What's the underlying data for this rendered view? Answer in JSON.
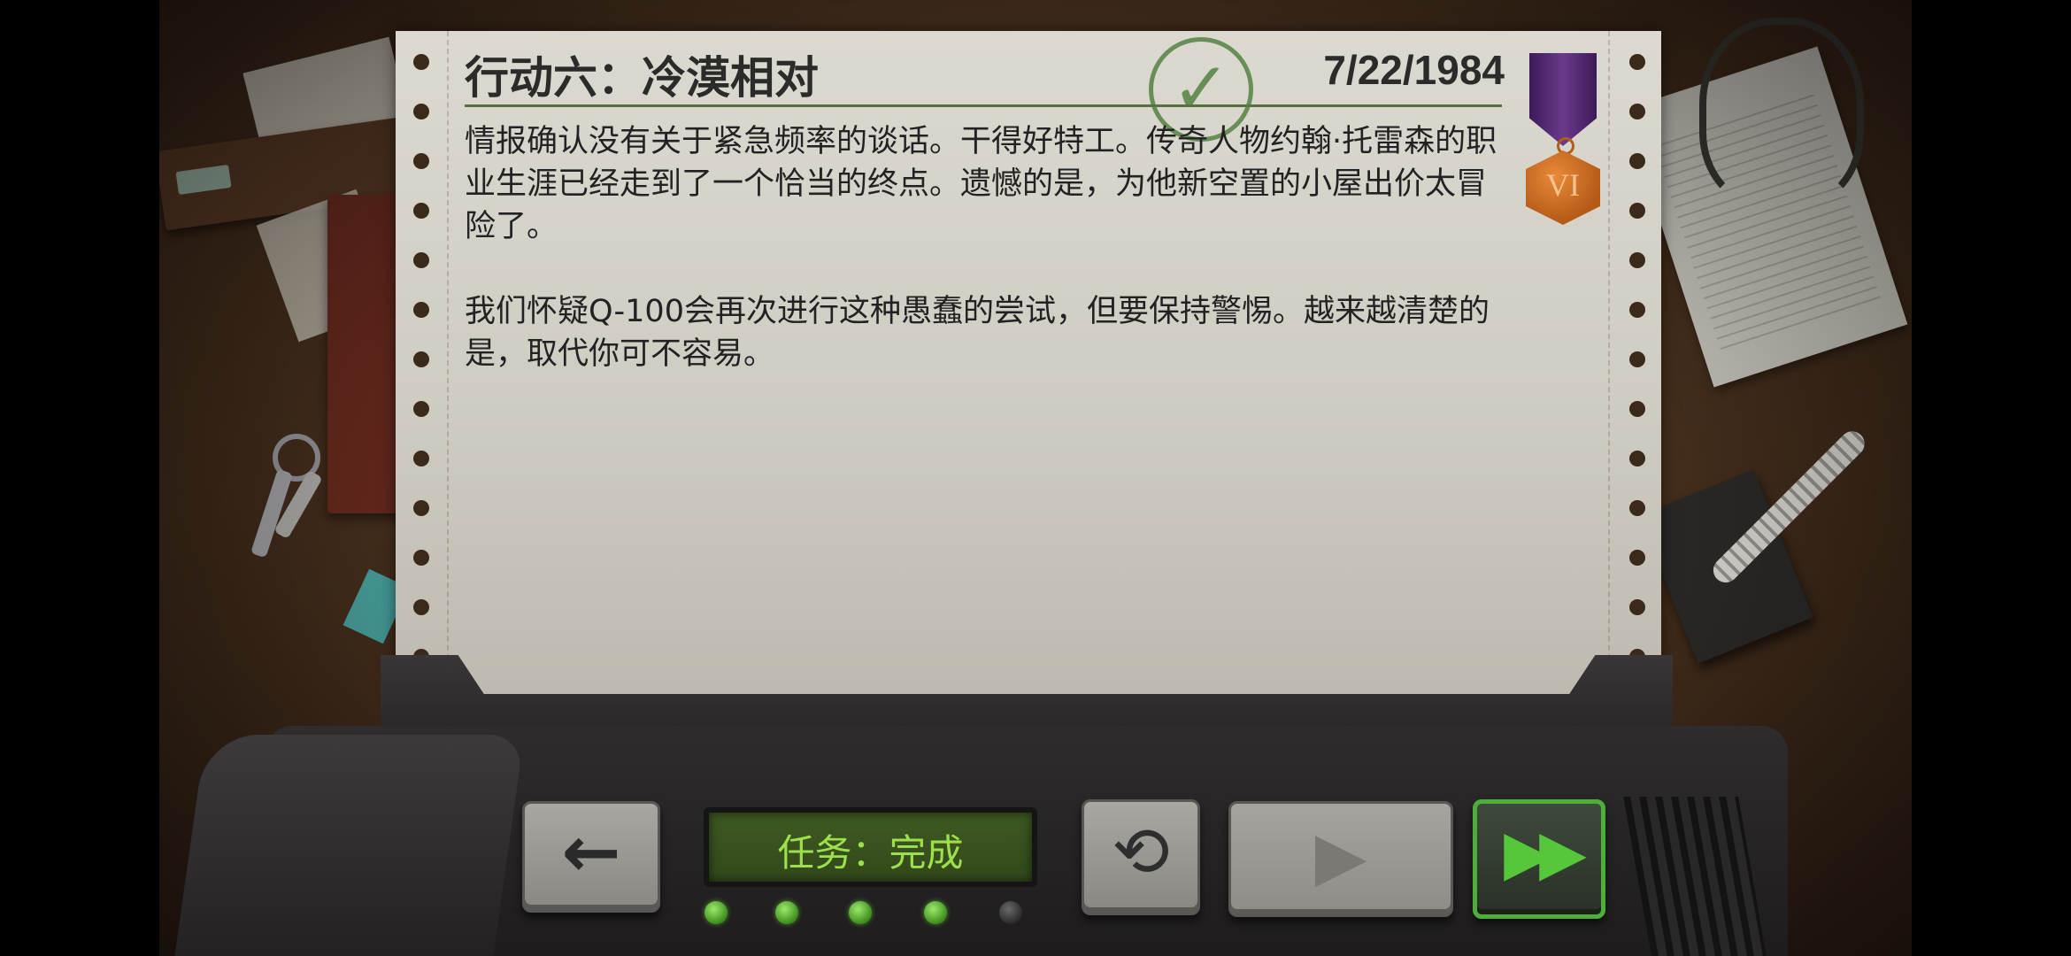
{
  "briefing": {
    "title": "行动六：冷漠相对",
    "date": "7/22/1984",
    "paragraphs": [
      "情报确认没有关于紧急频率的谈话。干得好特工。传奇人物约翰·托雷森的职业生涯已经走到了一个恰当的终点。遗憾的是，为他新空置的小屋出价太冒险了。",
      "我们怀疑Q-100会再次进行这种愚蠢的尝试，但要保持警惕。越来越清楚的是，取代你可不容易。"
    ],
    "stamp_icon": "checkmark-stamp-icon",
    "medal": {
      "numeral": "VI",
      "ribbon_color": "#5a2d7a",
      "medal_color": "#c96a22"
    }
  },
  "console": {
    "status_text": "任务：完成",
    "back_icon": "arrow-left-icon",
    "replay_icon": "replay-icon",
    "play_icon": "play-icon",
    "fast_forward_icon": "fast-forward-icon",
    "leds": [
      {
        "on": true
      },
      {
        "on": true
      },
      {
        "on": true
      },
      {
        "on": true
      },
      {
        "on": false
      }
    ],
    "accent_color": "#56c63b",
    "lcd_text_color": "#9ee04c"
  }
}
